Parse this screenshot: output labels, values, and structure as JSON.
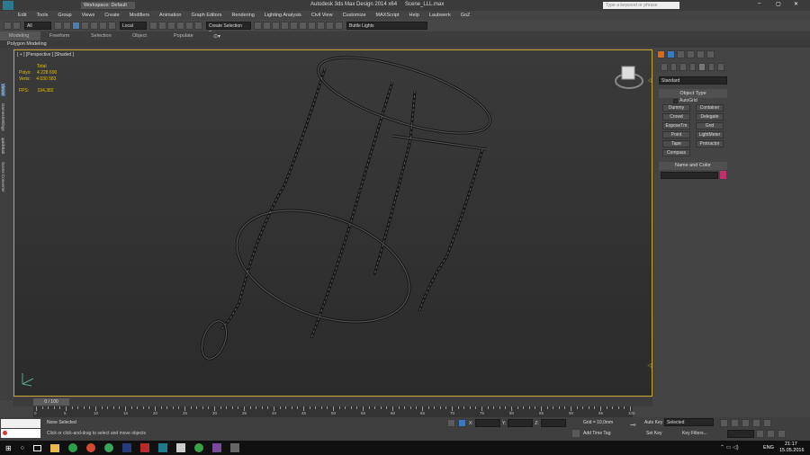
{
  "title": {
    "workspace": "Workspace: Default",
    "app": "Autodesk 3ds Max Design 2014 x64",
    "file": "Scene_LLL.max",
    "search_placeholder": "Type a keyword or phrase"
  },
  "menu": [
    "Edit",
    "Tools",
    "Group",
    "Views",
    "Create",
    "Modifiers",
    "Animation",
    "Graph Editors",
    "Rendering",
    "Lighting Analysis",
    "Civil View",
    "Customize",
    "MAXScript",
    "Help",
    "Laubwerk",
    "GoZ"
  ],
  "toolbar": {
    "filter": "All",
    "coord": "Local",
    "selection_set": "Create Selection Se",
    "named_set": "Buttle Lights"
  },
  "ribbon": {
    "tabs": [
      "Modeling",
      "Freeform",
      "Selection",
      "Object Paint",
      "Populate"
    ],
    "sub": "Polygon Modeling"
  },
  "viewport": {
    "label": "[ + ] [Perspective ] [Shaded ]",
    "stats": {
      "total": "Total",
      "polys_label": "Polys:",
      "polys": "4 228 690",
      "verts_label": "Verts:",
      "verts": "4 030 583",
      "fps_label": "FPS:",
      "fps": "194,382"
    }
  },
  "left_tabs": [
    "Viewer",
    "GamesSettings",
    "quickBalt",
    "Scene Converter"
  ],
  "cmd": {
    "dropdown": "Standard",
    "object_type": "Object Type",
    "autogrid": "AutoGrid",
    "buttons": [
      "Dummy",
      "Container",
      "Crowd",
      "Delegate",
      "ExposeTm",
      "Grid",
      "Point",
      "LightMeter",
      "Tape",
      "Protractor",
      "Compass"
    ],
    "name_color": "Name and Color"
  },
  "timeline": {
    "frame": "0 / 100",
    "ticks": [
      "0",
      "5",
      "10",
      "15",
      "20",
      "25",
      "30",
      "35",
      "40",
      "45",
      "50",
      "55",
      "60",
      "65",
      "70",
      "75",
      "80",
      "85",
      "90",
      "95",
      "100"
    ]
  },
  "status": {
    "none_selected": "None Selected",
    "hint": "Click or click-and-drag to select and move objects",
    "x": "X:",
    "y": "Y:",
    "z": "Z:",
    "grid": "Grid = 10,0mm",
    "add_time_tag": "Add Time Tag",
    "auto_key": "Auto Key",
    "selected": "Selected",
    "set_key": "Set Key",
    "key_filters": "Key Filters..."
  },
  "taskbar": {
    "lang": "ENG",
    "time": "21:17",
    "date": "15.05.2016"
  }
}
